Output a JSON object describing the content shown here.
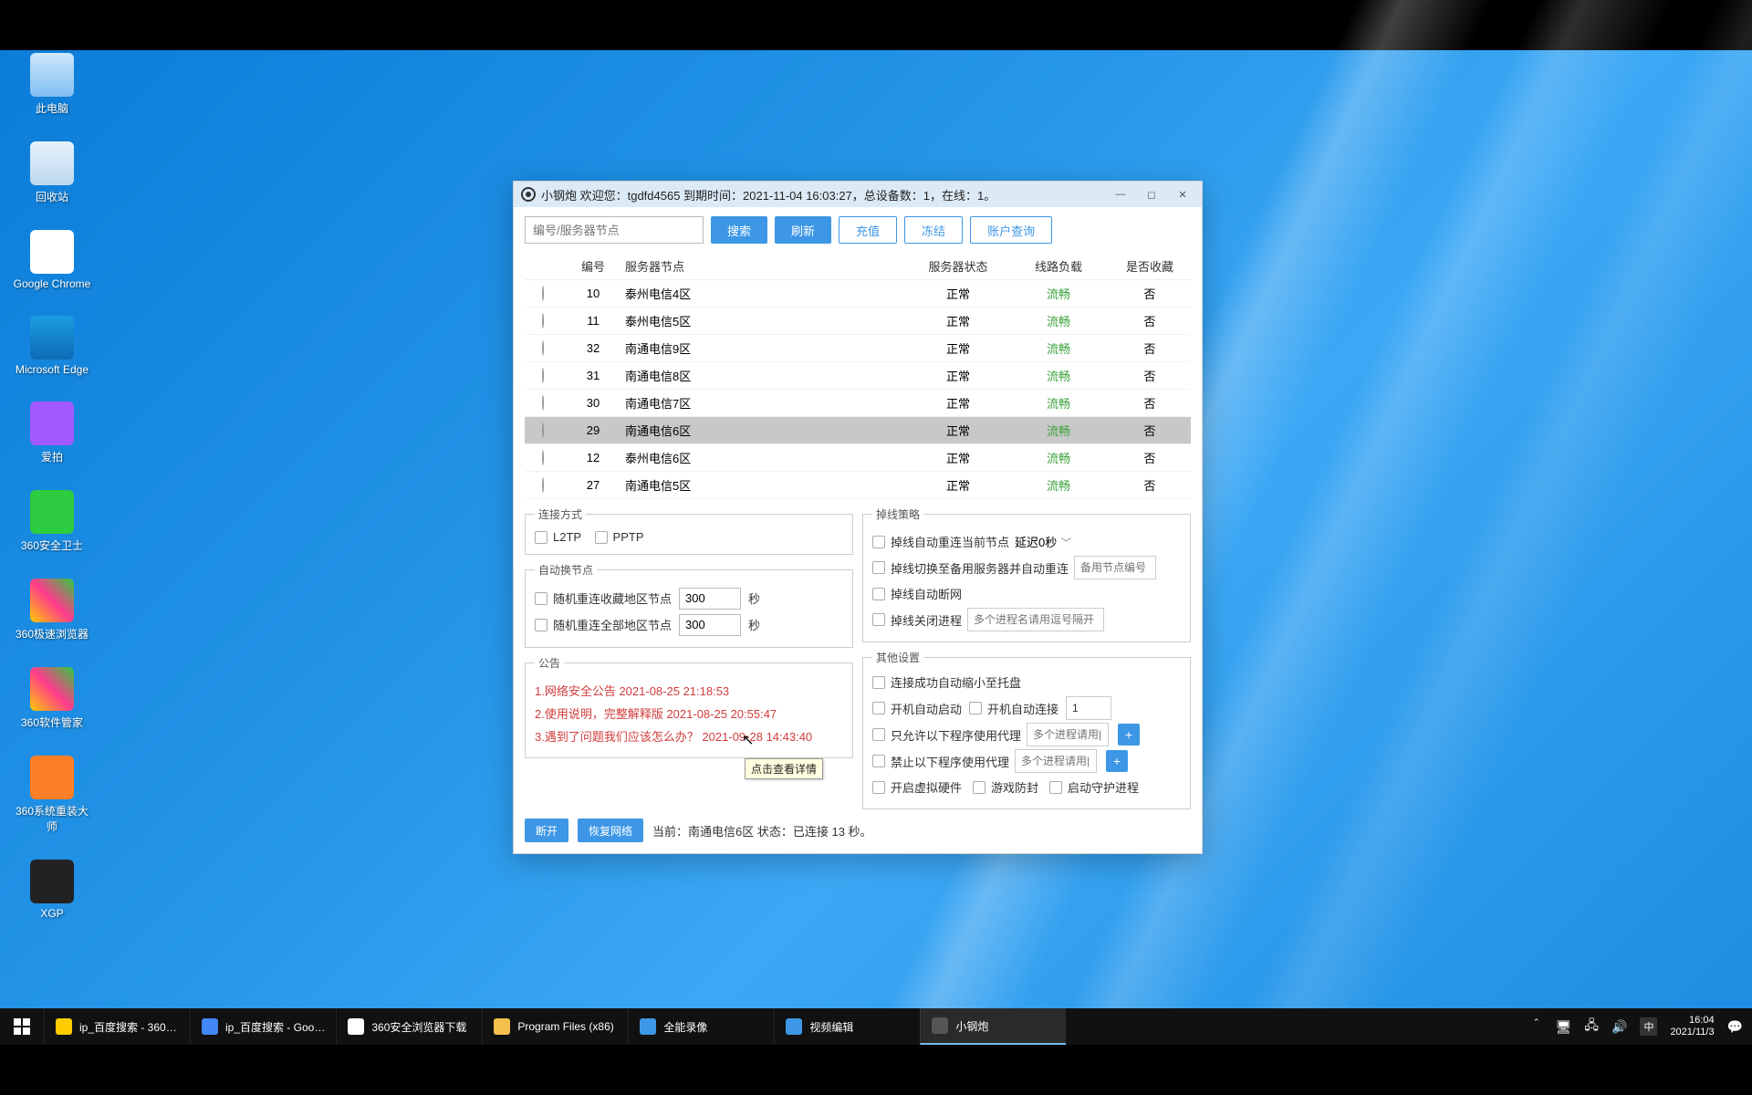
{
  "desktop_icons": [
    "此电脑",
    "回收站",
    "Google Chrome",
    "Microsoft Edge",
    "爱拍",
    "360安全卫士",
    "360极速浏览器",
    "360软件管家",
    "360系统重装大师",
    "XGP"
  ],
  "window": {
    "title": "小钢炮 欢迎您：tgdfd4565  到期时间：2021-11-04 16:03:27，总设备数：1，在线：1。",
    "search_placeholder": "编号/服务器节点",
    "buttons": {
      "search": "搜索",
      "refresh": "刷新",
      "recharge": "充值",
      "freeze": "冻结",
      "query": "账户查询"
    },
    "columns": [
      "",
      "编号",
      "服务器节点",
      "服务器状态",
      "线路负载",
      "是否收藏"
    ],
    "rows": [
      {
        "id": "10",
        "name": "泰州电信4区",
        "status": "正常",
        "load": "流畅",
        "fav": "否",
        "selected": false
      },
      {
        "id": "11",
        "name": "泰州电信5区",
        "status": "正常",
        "load": "流畅",
        "fav": "否",
        "selected": false
      },
      {
        "id": "32",
        "name": "南通电信9区",
        "status": "正常",
        "load": "流畅",
        "fav": "否",
        "selected": false
      },
      {
        "id": "31",
        "name": "南通电信8区",
        "status": "正常",
        "load": "流畅",
        "fav": "否",
        "selected": false
      },
      {
        "id": "30",
        "name": "南通电信7区",
        "status": "正常",
        "load": "流畅",
        "fav": "否",
        "selected": false
      },
      {
        "id": "29",
        "name": "南通电信6区",
        "status": "正常",
        "load": "流畅",
        "fav": "否",
        "selected": true
      },
      {
        "id": "12",
        "name": "泰州电信6区",
        "status": "正常",
        "load": "流畅",
        "fav": "否",
        "selected": false
      },
      {
        "id": "27",
        "name": "南通电信5区",
        "status": "正常",
        "load": "流畅",
        "fav": "否",
        "selected": false
      }
    ],
    "conn": {
      "legend": "连接方式",
      "l2tp": "L2TP",
      "pptp": "PPTP"
    },
    "autosw": {
      "legend": "自动换节点",
      "fav_label": "随机重连收藏地区节点",
      "fav_val": "300",
      "fav_unit": "秒",
      "all_label": "随机重连全部地区节点",
      "all_val": "300",
      "all_unit": "秒"
    },
    "notice": {
      "legend": "公告",
      "items": [
        "1.网络安全公告 2021-08-25 21:18:53",
        "2.使用说明，完整解释版 2021-08-25 20:55:47",
        "3.遇到了问题我们应该怎么办？ 2021-09-28 14:43:40"
      ],
      "tooltip": "点击查看详情"
    },
    "drop": {
      "legend": "掉线策略",
      "reconnect": "掉线自动重连当前节点",
      "latency": "延迟0秒",
      "switch": "掉线切换至备用服务器并自动重连",
      "backup_placeholder": "备用节点编号",
      "disconnect": "掉线自动断网",
      "close_proc": "掉线关闭进程",
      "close_placeholder": "多个进程名请用逗号隔开"
    },
    "other": {
      "legend": "其他设置",
      "tray": "连接成功自动缩小至托盘",
      "autostart": "开机自动启动",
      "autoconnect": "开机自动连接",
      "autoconnect_val": "1",
      "allow_only": "只允许以下程序使用代理",
      "allow_placeholder": "多个进程请用|隔开",
      "deny": "禁止以下程序使用代理",
      "deny_placeholder": "多个进程请用|隔开",
      "virtual": "开启虚拟硬件",
      "game": "游戏防封",
      "guard": "启动守护进程"
    },
    "footer": {
      "disconnect": "断开",
      "restore": "恢复网络",
      "status": "当前：南通电信6区 状态：已连接 13 秒。"
    }
  },
  "taskbar": {
    "items": [
      {
        "label": "ip_百度搜索 - 360…",
        "color": "#ffcc00"
      },
      {
        "label": "ip_百度搜索 - Goo…",
        "color": "#4285f4"
      },
      {
        "label": "360安全浏览器下载",
        "color": "#fff"
      },
      {
        "label": "Program Files (x86)",
        "color": "#f6c04d"
      },
      {
        "label": "全能录像",
        "color": "#3d97e6"
      },
      {
        "label": "视频编辑",
        "color": "#3d97e6"
      },
      {
        "label": "小钢炮",
        "color": "#555",
        "active": true
      }
    ],
    "ime": "中",
    "time": "16:04",
    "date": "2021/11/3"
  }
}
